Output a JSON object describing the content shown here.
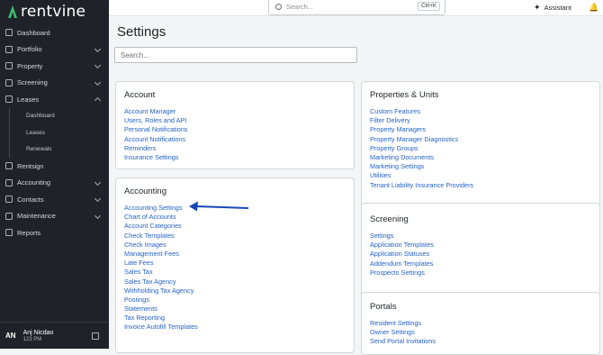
{
  "app": {
    "logo_text": "rentvine"
  },
  "sidebar": {
    "items": [
      {
        "label": "Dashboard",
        "icon": "dashboard-icon",
        "chevron": ""
      },
      {
        "label": "Portfolio",
        "icon": "portfolio-icon",
        "chevron": "down"
      },
      {
        "label": "Property",
        "icon": "property-icon",
        "chevron": "down"
      },
      {
        "label": "Screening",
        "icon": "screening-icon",
        "chevron": "down"
      },
      {
        "label": "Leases",
        "icon": "leases-icon",
        "chevron": "up"
      }
    ],
    "leases_sub": [
      "Dashboard",
      "Leases",
      "Renewals"
    ],
    "items2": [
      {
        "label": "Rentsign",
        "icon": "rentsign-icon",
        "chevron": ""
      },
      {
        "label": "Accounting",
        "icon": "accounting-icon",
        "chevron": "down"
      },
      {
        "label": "Contacts",
        "icon": "contacts-icon",
        "chevron": "down"
      },
      {
        "label": "Maintenance",
        "icon": "maintenance-icon",
        "chevron": "down"
      },
      {
        "label": "Reports",
        "icon": "reports-icon",
        "chevron": ""
      }
    ],
    "user": {
      "initials": "AN",
      "name": "Anj Nicdao",
      "time": "123 PM"
    }
  },
  "topbar": {
    "search_placeholder": "Search...",
    "shortcut": "Ctrl+K",
    "assistant_label": "Assistant"
  },
  "page": {
    "title": "Settings",
    "search_placeholder": "Search..."
  },
  "cards": {
    "account": {
      "title": "Account",
      "links": [
        "Account Manager",
        "Users, Roles and API",
        "Personal Notifications",
        "Account Notifications",
        "Reminders",
        "Insurance Settings"
      ]
    },
    "accounting": {
      "title": "Accounting",
      "links": [
        "Accounting Settings",
        "Chart of Accounts",
        "Account Categories",
        "Check Templates",
        "Check Images",
        "Management Fees",
        "Late Fees",
        "Sales Tax",
        "Sales Tax Agency",
        "Withholding Tax Agency",
        "Postings",
        "Statements",
        "Tax Reporting",
        "Invoice Autofill Templates"
      ]
    },
    "properties": {
      "title": "Properties & Units",
      "links": [
        "Custom Features",
        "Filter Delivery",
        "Property Managers",
        "Property Manager Diagnostics",
        "Property Groups",
        "Marketing Documents",
        "Marketing Settings",
        "Utilities",
        "Tenant Liability Insurance Providers"
      ]
    },
    "screening": {
      "title": "Screening",
      "links": [
        "Settings",
        "Application Templates",
        "Application Statuses",
        "Addendum Templates",
        "Prospects Settings"
      ]
    },
    "portals": {
      "title": "Portals",
      "links": [
        "Resident Settings",
        "Owner Settings",
        "Send Portal Invitations"
      ]
    }
  },
  "colors": {
    "sidebar_bg": "#1f2329",
    "link": "#2563c7",
    "arrow": "#1747b8"
  }
}
